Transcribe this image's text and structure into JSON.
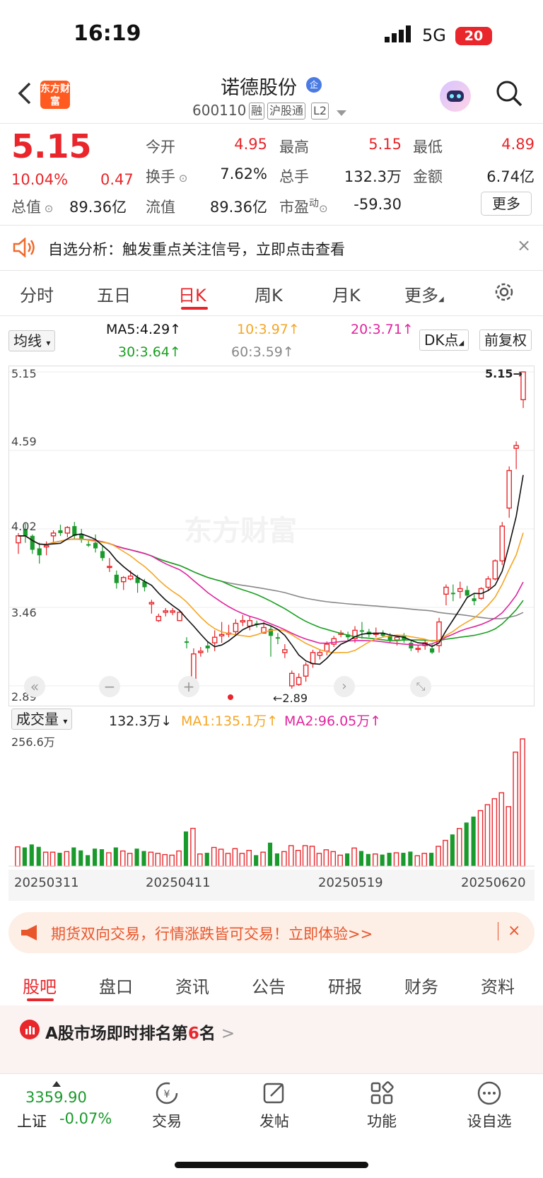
{
  "status": {
    "time": "16:19",
    "network": "5G",
    "battery": "20"
  },
  "header": {
    "name": "诺德股份",
    "badge": "企",
    "code": "600110",
    "tags": [
      "融",
      "沪股通",
      "L2"
    ],
    "logo": "东方财富"
  },
  "quote": {
    "price": "5.15",
    "pct": "10.04%",
    "change": "0.47",
    "total_value_label": "总值",
    "total_value": "89.36亿",
    "items": [
      {
        "label": "今开",
        "value": "4.95"
      },
      {
        "label": "最高",
        "value": "5.15"
      },
      {
        "label": "最低",
        "value": "4.89"
      },
      {
        "label": "换手",
        "value": "7.62%"
      },
      {
        "label": "总手",
        "value": "132.3万"
      },
      {
        "label": "金额",
        "value": "6.74亿"
      },
      {
        "label": "流值",
        "value": "89.36亿"
      },
      {
        "label": "市盈",
        "sup": "动",
        "value": "-59.30"
      }
    ],
    "more": "更多"
  },
  "notice": {
    "text": "自选分析：触发重点关注信号，立即点击查看",
    "close": "×"
  },
  "ktabs": [
    "分时",
    "五日",
    "日K",
    "周K",
    "月K",
    "更多"
  ],
  "ma": {
    "selector": "均线",
    "ma5": "MA5:4.29↑",
    "ma10": "10:3.97↑",
    "ma20": "20:3.71↑",
    "ma30": "30:3.64↑",
    "ma60": "60:3.59↑",
    "dk": "DK点",
    "fq": "前复权",
    "colors": {
      "ma5": "#111111",
      "ma10": "#f5a623",
      "ma20": "#e0249e",
      "ma30": "#1aa021",
      "ma60": "#888888"
    }
  },
  "chart": {
    "y_labels": [
      "5.15",
      "4.59",
      "4.02",
      "3.46",
      "2.89"
    ],
    "max_label": "5.15→",
    "min_label": "←2.89",
    "watermark": "东方财富"
  },
  "volume": {
    "selector": "成交量",
    "value": "132.3万↓",
    "ma1": "MA1:135.1万↑",
    "ma2": "MA2:96.05万↑",
    "max_label": "256.6万",
    "dates": [
      "20250311",
      "20250411",
      "20250519",
      "20250620"
    ]
  },
  "chart_data": {
    "type": "candlestick",
    "ylim": [
      2.89,
      5.15
    ],
    "candles": [
      [
        3.92,
        3.99,
        3.84,
        3.97
      ],
      [
        4.02,
        4.06,
        3.92,
        3.97
      ],
      [
        3.97,
        3.98,
        3.84,
        3.87
      ],
      [
        3.88,
        3.92,
        3.77,
        3.83
      ],
      [
        3.89,
        3.93,
        3.83,
        3.9
      ],
      [
        3.97,
        4.01,
        3.92,
        3.99
      ],
      [
        4.01,
        4.05,
        3.97,
        3.99
      ],
      [
        3.99,
        4.04,
        3.96,
        4.03
      ],
      [
        4.04,
        4.07,
        3.95,
        3.97
      ],
      [
        3.98,
        4.02,
        3.92,
        3.94
      ],
      [
        3.91,
        3.94,
        3.89,
        3.9
      ],
      [
        3.92,
        3.98,
        3.85,
        3.88
      ],
      [
        3.86,
        3.9,
        3.79,
        3.81
      ],
      [
        3.75,
        3.81,
        3.71,
        3.75
      ],
      [
        3.69,
        3.72,
        3.59,
        3.63
      ],
      [
        3.64,
        3.68,
        3.58,
        3.67
      ],
      [
        3.66,
        3.72,
        3.65,
        3.68
      ],
      [
        3.67,
        3.69,
        3.56,
        3.63
      ],
      [
        3.64,
        3.66,
        3.57,
        3.6
      ],
      [
        3.48,
        3.51,
        3.41,
        3.49
      ],
      [
        3.36,
        3.41,
        3.35,
        3.39
      ],
      [
        3.42,
        3.45,
        3.39,
        3.43
      ],
      [
        3.42,
        3.45,
        3.4,
        3.43
      ],
      [
        3.36,
        3.43,
        3.36,
        3.42
      ],
      [
        3.21,
        3.24,
        3.16,
        3.2
      ],
      [
        2.85,
        3.16,
        2.92,
        3.12
      ],
      [
        3.13,
        3.17,
        3.1,
        3.14
      ],
      [
        3.18,
        3.21,
        3.13,
        3.16
      ],
      [
        3.2,
        3.29,
        3.14,
        3.24
      ],
      [
        3.25,
        3.35,
        3.2,
        3.26
      ],
      [
        3.27,
        3.33,
        3.24,
        3.27
      ],
      [
        3.28,
        3.37,
        3.26,
        3.34
      ],
      [
        3.35,
        3.4,
        3.32,
        3.36
      ],
      [
        3.32,
        3.39,
        3.29,
        3.36
      ],
      [
        3.34,
        3.36,
        3.31,
        3.33
      ],
      [
        3.27,
        3.35,
        3.28,
        3.31
      ],
      [
        3.3,
        3.32,
        3.1,
        3.25
      ],
      [
        3.24,
        3.27,
        3.19,
        3.23
      ],
      [
        3.13,
        3.19,
        3.09,
        3.15
      ],
      [
        2.89,
        3.0,
        2.87,
        2.98
      ],
      [
        2.9,
        2.98,
        2.89,
        2.95
      ],
      [
        2.96,
        3.06,
        2.92,
        3.04
      ],
      [
        3.05,
        3.15,
        3.02,
        3.13
      ],
      [
        3.11,
        3.15,
        3.08,
        3.13
      ],
      [
        3.14,
        3.21,
        3.11,
        3.19
      ],
      [
        3.19,
        3.25,
        3.17,
        3.23
      ],
      [
        3.26,
        3.29,
        3.24,
        3.27
      ],
      [
        3.26,
        3.28,
        3.21,
        3.24
      ],
      [
        3.23,
        3.32,
        3.2,
        3.29
      ],
      [
        3.29,
        3.35,
        3.23,
        3.28
      ],
      [
        3.28,
        3.3,
        3.24,
        3.26
      ],
      [
        3.26,
        3.31,
        3.24,
        3.27
      ],
      [
        3.27,
        3.29,
        3.24,
        3.25
      ],
      [
        3.25,
        3.27,
        3.2,
        3.22
      ],
      [
        3.22,
        3.26,
        3.18,
        3.24
      ],
      [
        3.25,
        3.27,
        3.2,
        3.22
      ],
      [
        3.2,
        3.22,
        3.14,
        3.16
      ],
      [
        3.16,
        3.18,
        3.13,
        3.16
      ],
      [
        3.18,
        3.22,
        3.15,
        3.2
      ],
      [
        3.16,
        3.19,
        3.12,
        3.13
      ],
      [
        3.18,
        3.38,
        3.13,
        3.35
      ],
      [
        3.55,
        3.62,
        3.47,
        3.6
      ],
      [
        3.56,
        3.62,
        3.5,
        3.55
      ],
      [
        3.57,
        3.64,
        3.52,
        3.59
      ],
      [
        3.58,
        3.61,
        3.52,
        3.54
      ],
      [
        3.52,
        3.55,
        3.47,
        3.5
      ],
      [
        3.52,
        3.6,
        3.51,
        3.59
      ],
      [
        3.6,
        3.68,
        3.58,
        3.66
      ],
      [
        3.66,
        3.8,
        3.65,
        3.79
      ],
      [
        3.79,
        4.07,
        3.76,
        4.04
      ],
      [
        4.17,
        4.47,
        4.1,
        4.44
      ],
      [
        4.6,
        4.65,
        4.45,
        4.62
      ],
      [
        4.95,
        5.15,
        4.89,
        5.15
      ]
    ],
    "volume_max": 256.6
  },
  "ad": {
    "text": "期货双向交易，行情涨跌皆可交易！立即体验>>",
    "close": "×"
  },
  "bottom_tabs": [
    "股吧",
    "盘口",
    "资讯",
    "公告",
    "研报",
    "财务",
    "资料"
  ],
  "rank": {
    "prefix": "A股市场即时排名第",
    "rank": "6",
    "suffix": "名",
    "arrow": ">"
  },
  "nav": {
    "index_value": "3359.90",
    "index_name": "上证",
    "index_pct": "-0.07%",
    "items": [
      "交易",
      "发帖",
      "功能",
      "设自选"
    ]
  }
}
